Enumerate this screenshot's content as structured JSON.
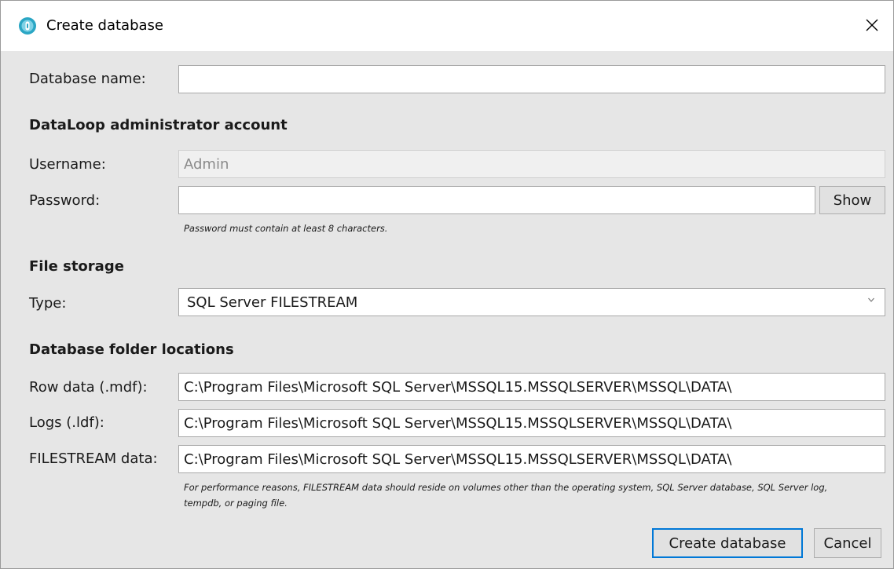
{
  "window": {
    "title": "Create database",
    "app_icon": "dataloop-icon",
    "close_icon": "close-icon"
  },
  "database_name": {
    "label": "Database name:",
    "value": "",
    "placeholder": ""
  },
  "admin": {
    "heading": "DataLoop administrator account",
    "username_label": "Username:",
    "username_value": "Admin",
    "password_label": "Password:",
    "password_value": "",
    "show_label": "Show",
    "password_hint": "Password must contain at least 8 characters."
  },
  "file_storage": {
    "heading": "File storage",
    "type_label": "Type:",
    "type_value": "SQL Server FILESTREAM"
  },
  "folders": {
    "heading": "Database folder locations",
    "row_data_label": "Row data (.mdf):",
    "row_data_value": "C:\\Program Files\\Microsoft SQL Server\\MSSQL15.MSSQLSERVER\\MSSQL\\DATA\\",
    "logs_label": "Logs (.ldf):",
    "logs_value": "C:\\Program Files\\Microsoft SQL Server\\MSSQL15.MSSQLSERVER\\MSSQL\\DATA\\",
    "filestream_label": "FILESTREAM data:",
    "filestream_value": "C:\\Program Files\\Microsoft SQL Server\\MSSQL15.MSSQLSERVER\\MSSQL\\DATA\\",
    "filestream_hint": "For performance reasons, FILESTREAM data should reside on volumes other than the operating system, SQL Server database, SQL Server log, tempdb, or paging file."
  },
  "actions": {
    "create_label": "Create database",
    "cancel_label": "Cancel"
  },
  "colors": {
    "accent": "#0078d7",
    "dialog_bg": "#e6e6e6"
  }
}
